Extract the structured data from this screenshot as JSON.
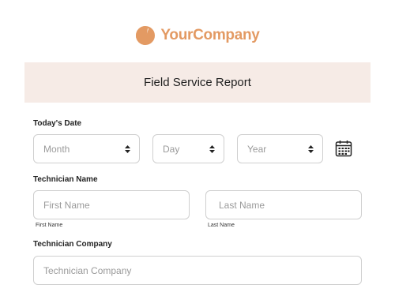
{
  "logo": {
    "text": "YourCompany",
    "icon": "half-circle-logo-icon"
  },
  "banner": {
    "title": "Field Service Report"
  },
  "date_section": {
    "label": "Today's Date",
    "month_placeholder": "Month",
    "day_placeholder": "Day",
    "year_placeholder": "Year",
    "calendar_icon": "calendar-icon"
  },
  "technician_name": {
    "label": "Technician Name",
    "first_placeholder": "First Name",
    "last_placeholder": "Last Name",
    "first_sublabel": "First Name",
    "last_sublabel": "Last Name"
  },
  "technician_company": {
    "label": "Technician Company",
    "placeholder": "Technician Company"
  },
  "colors": {
    "brand": "#e39a63",
    "banner_bg": "#f6ebe6",
    "border": "#cfcfcf"
  }
}
